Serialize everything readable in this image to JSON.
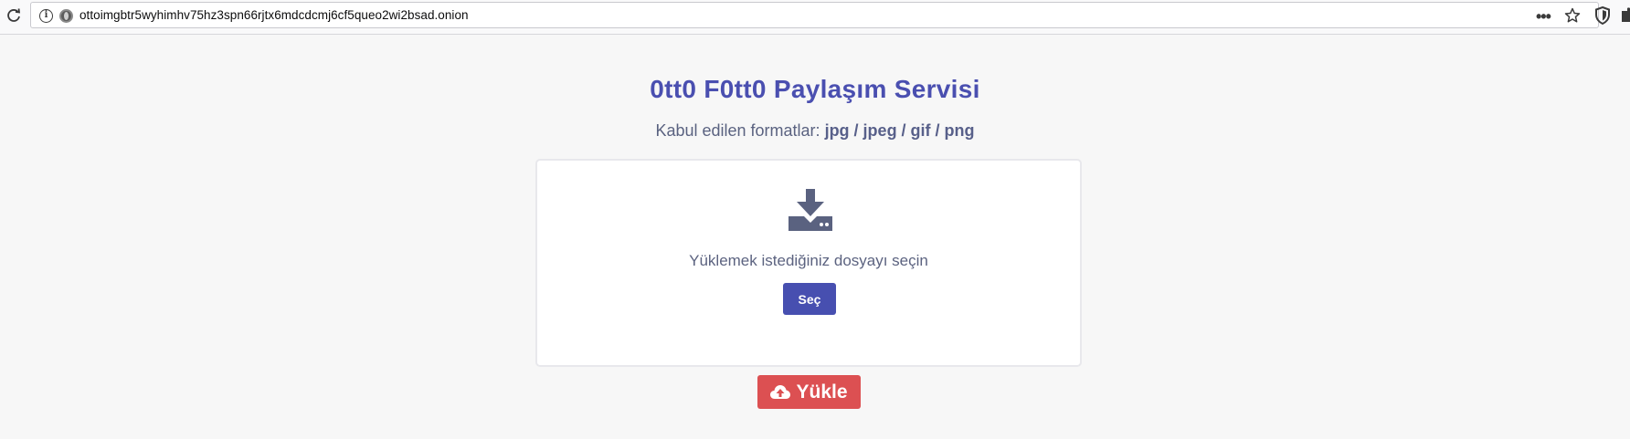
{
  "browser": {
    "url": "ottoimgbtr5wyhimhv75hz3spn66rjtx6mdcdcmj6cf5queo2wi2bsad.onion",
    "info_icon": "i",
    "more_label": "•••"
  },
  "page": {
    "title": "0tt0 F0tt0 Paylaşım Servisi",
    "subtitle_prefix": "Kabul edilen formatlar:",
    "formats": "jpg / jpeg / gif / png",
    "card_text": "Yüklemek istediğiniz dosyayı seçin",
    "select_label": "Seç",
    "upload_label": "Yükle"
  },
  "icons": {
    "reload": "reload-icon",
    "info": "info-icon",
    "onion": "onion-icon",
    "more": "more-icon",
    "star": "star-icon",
    "shield": "shield-icon",
    "extension": "extension-icon",
    "download": "download-icon",
    "cloud_upload": "cloud-upload-icon"
  },
  "colors": {
    "title": "#4a4fb0",
    "select_button": "#474fb0",
    "upload_button": "#dc5052",
    "icon_gray": "#5a6280"
  }
}
